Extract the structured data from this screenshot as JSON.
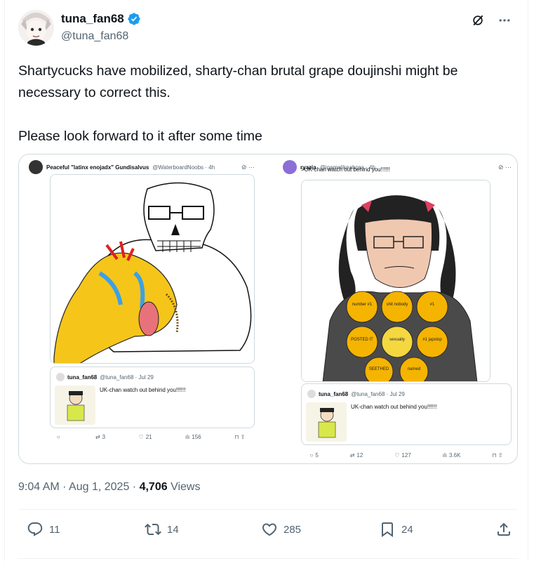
{
  "author": {
    "display_name": "tuna_fan68",
    "handle": "@tuna_fan68"
  },
  "tweet": {
    "text": "Shartycucks have mobilized, sharty-chan brutal grape doujinshi might be necessary to correct this.\n\nPlease look forward to it after some time",
    "timestamp": "9:04 AM · Aug 1, 2025",
    "sep": "·",
    "views_count": "4,706",
    "views_label": "Views"
  },
  "stats": {
    "replies": "11",
    "retweets": "14",
    "likes": "285",
    "bookmarks": "24"
  },
  "media": {
    "left": {
      "name": "Peaceful \"latinx enojadx\" Gundisalvus",
      "handle": "@WaterboardNoobs · 4h",
      "quote": {
        "name": "tuna_fan68",
        "handle": "@tuna_fan68 · Jul 29",
        "text": "UK-chan watch out behind you!!!!!!"
      },
      "actions": {
        "replies": "",
        "retweets": "3",
        "likes": "21",
        "views": "156"
      }
    },
    "right": {
      "name": "ryazia",
      "handle": "@igamelikeaboss · 4h",
      "text": ">UK-chan watch out behind you!!!!!!",
      "medals": [
        "number #1 \"twitter freak\" hater award",
        "shit nobody cares about award",
        "#1 \"hoodwees\" hater award",
        "POSTED IT AGAIN AWARD",
        "sexually attracted to kids award",
        "#1 japslop lover award",
        "SEETHED ABOUT IT AGAIN AWARD",
        "named them again award"
      ],
      "quote": {
        "name": "tuna_fan68",
        "handle": "@tuna_fan68 · Jul 29",
        "text": "UK-chan watch out behind you!!!!!!"
      },
      "actions": {
        "replies": "5",
        "retweets": "12",
        "likes": "127",
        "views": "3.6K"
      }
    }
  },
  "colors": {
    "accent": "#1d9bf0",
    "text": "#0f1419",
    "muted": "#536471",
    "border": "#cfd9de"
  }
}
